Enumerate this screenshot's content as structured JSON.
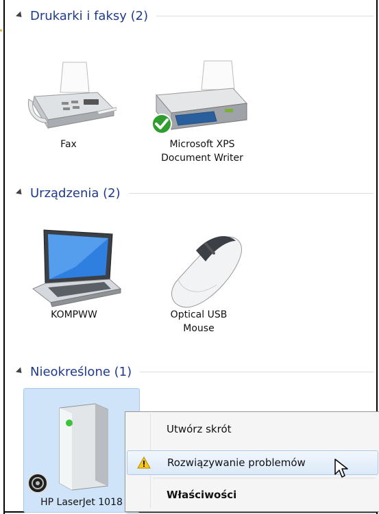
{
  "groups": {
    "printers": {
      "title": "Drukarki i faksy (2)"
    },
    "devices": {
      "title": "Urządzenia (2)"
    },
    "unspecified": {
      "title": "Nieokreślone (1)"
    }
  },
  "items": {
    "fax": {
      "label": "Fax",
      "icon": "fax-icon"
    },
    "xps": {
      "label_line1": "Microsoft XPS",
      "label_line2": "Document Writer",
      "icon": "printer-icon",
      "badge": "default-check-icon"
    },
    "kompww": {
      "label": "KOMPWW",
      "icon": "laptop-icon"
    },
    "mouse": {
      "label_line1": "Optical USB",
      "label_line2": "Mouse",
      "icon": "mouse-icon"
    },
    "hp": {
      "label": "HP LaserJet 1018",
      "icon": "generic-device-icon",
      "badge": "unknown-device-icon"
    }
  },
  "context_menu": {
    "items": [
      {
        "label": "Utwórz skrót"
      },
      {
        "label": "Rozwiązywanie problemów",
        "icon": "warning-shield-icon",
        "highlighted": true
      },
      {
        "label": "Właściwości",
        "bold": true
      }
    ]
  },
  "colors": {
    "header": "#1e3a8a",
    "selection": "#cfe4f8",
    "check": "#2f9e2f"
  }
}
